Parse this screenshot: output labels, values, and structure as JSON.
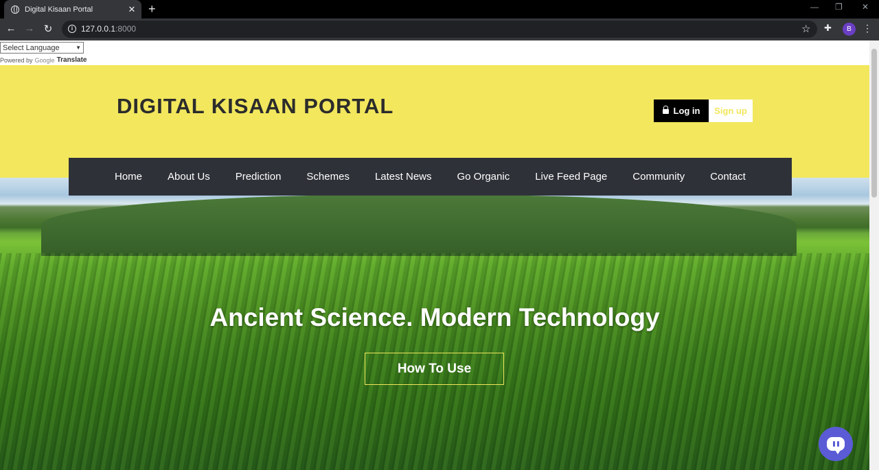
{
  "browser": {
    "tab_title": "Digital Kisaan Portal",
    "tab_close": "✕",
    "new_tab": "+",
    "url_host": "127.0.0.1",
    "url_port": ":8000",
    "profile_initial": "B",
    "back": "←",
    "forward": "→",
    "reload": "↻",
    "star": "☆",
    "menu": "⋮",
    "minimize": "—",
    "restore": "❐",
    "close": "✕"
  },
  "translate": {
    "select_label": "Select Language",
    "powered_by": "Powered by",
    "google": "Google",
    "translate": "Translate"
  },
  "header": {
    "title": "DIGITAL KISAAN PORTAL",
    "login_label": "Log in",
    "signup_label": "Sign up"
  },
  "nav": {
    "items": [
      "Home",
      "About Us",
      "Prediction",
      "Schemes",
      "Latest News",
      "Go Organic",
      "Live Feed Page",
      "Community",
      "Contact"
    ]
  },
  "hero": {
    "title": "Ancient Science. Modern Technology",
    "button_label": "How To Use"
  },
  "colors": {
    "header_bg": "#f2e75d",
    "nav_bg": "#2f3139",
    "chat_bg": "#5b5bd6"
  },
  "icons": [
    "globe-icon",
    "lock-icon",
    "chat-icon",
    "star-icon",
    "extensions-icon",
    "info-icon"
  ]
}
